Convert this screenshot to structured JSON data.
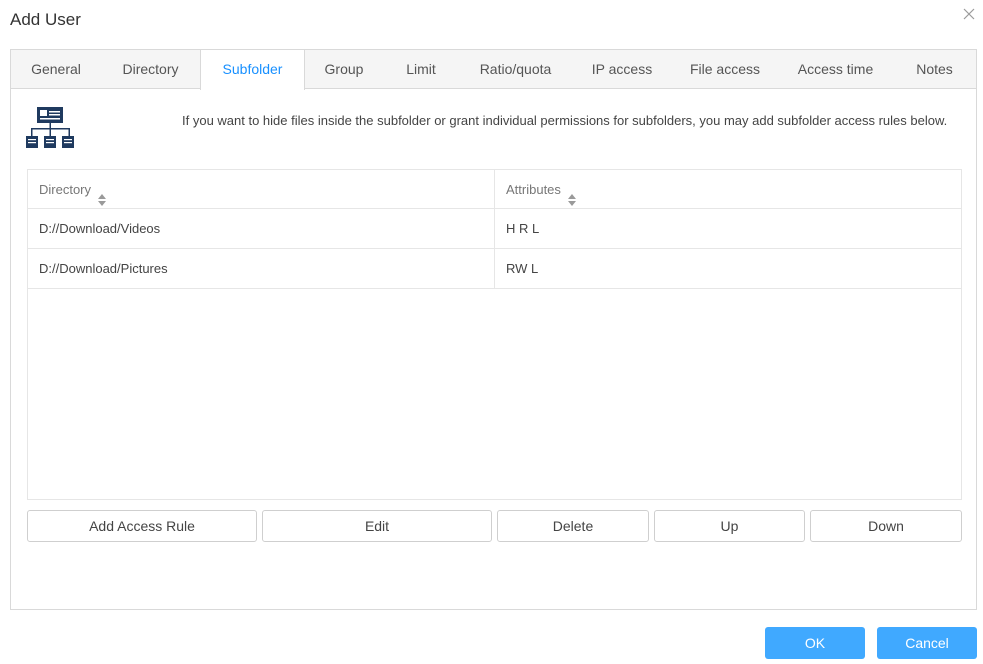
{
  "dialog": {
    "title": "Add User"
  },
  "tabs": [
    {
      "label": "General"
    },
    {
      "label": "Directory"
    },
    {
      "label": "Subfolder",
      "active": true
    },
    {
      "label": "Group"
    },
    {
      "label": "Limit"
    },
    {
      "label": "Ratio/quota"
    },
    {
      "label": "IP access"
    },
    {
      "label": "File access"
    },
    {
      "label": "Access time"
    },
    {
      "label": "Notes"
    }
  ],
  "subfolder": {
    "icon": "hierarchy-icon",
    "info_text": "If you want to hide files inside the subfolder or grant individual permissions for subfolders, you may add subfolder access rules below.",
    "table": {
      "columns": [
        "Directory",
        "Attributes"
      ],
      "rows": [
        {
          "directory": "D://Download/Videos",
          "attributes": "H R L"
        },
        {
          "directory": "D://Download/Pictures",
          "attributes": "RW L"
        }
      ]
    },
    "buttons": {
      "add": "Add Access Rule",
      "edit": "Edit",
      "delete": "Delete",
      "up": "Up",
      "down": "Down"
    }
  },
  "footer": {
    "ok": "OK",
    "cancel": "Cancel"
  },
  "colors": {
    "accent": "#1890ff",
    "primary_button": "#40a9ff",
    "icon": "#1f3a5f"
  }
}
